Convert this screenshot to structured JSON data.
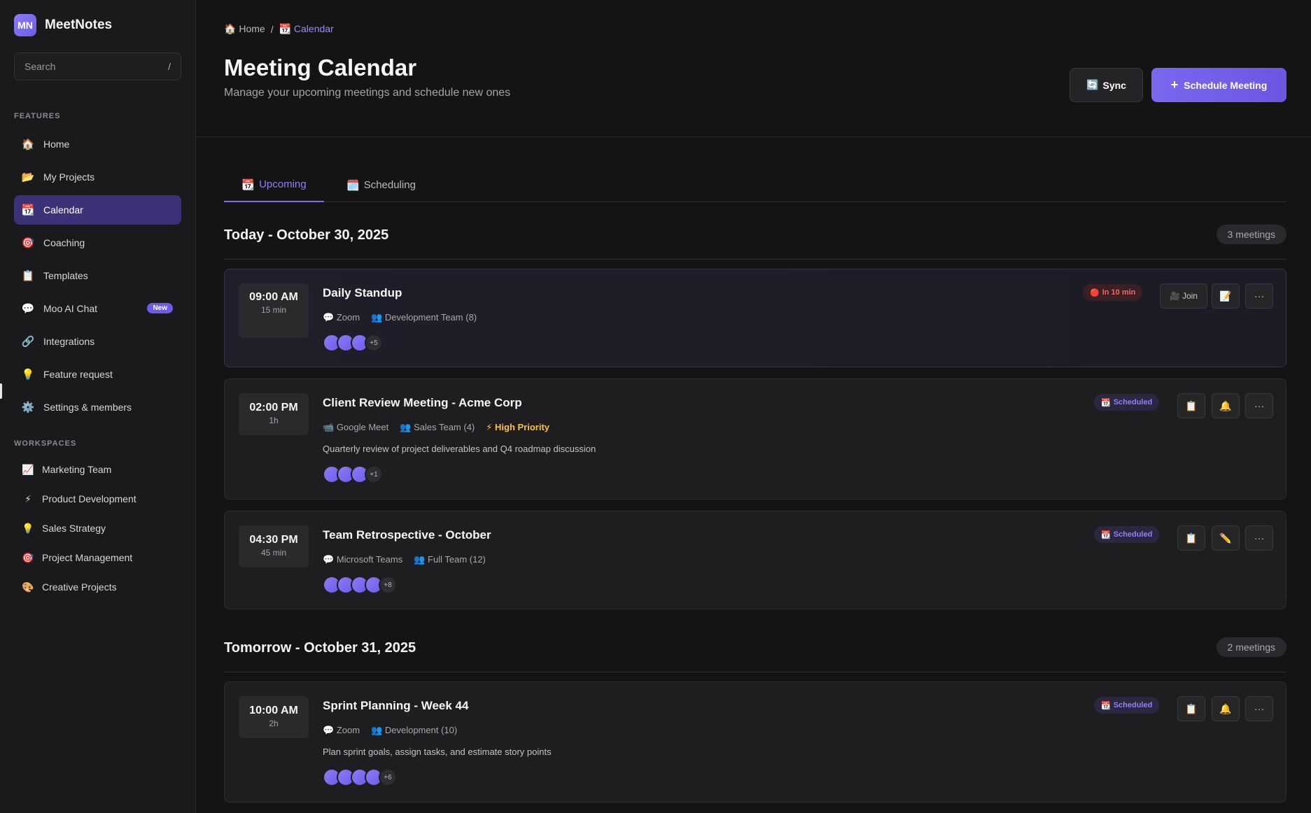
{
  "brand": {
    "logo": "MN",
    "name": "MeetNotes"
  },
  "search": {
    "placeholder": "Search",
    "shortcut": "/"
  },
  "sidebar": {
    "features_label": "FEATURES",
    "items": [
      {
        "icon": "🏠",
        "label": "Home"
      },
      {
        "icon": "📂",
        "label": "My Projects"
      },
      {
        "icon": "📆",
        "label": "Calendar"
      },
      {
        "icon": "🎯",
        "label": "Coaching"
      },
      {
        "icon": "📋",
        "label": "Templates"
      },
      {
        "icon": "💬",
        "label": "Moo AI Chat",
        "badge": "New"
      },
      {
        "icon": "🔗",
        "label": "Integrations"
      },
      {
        "icon": "💡",
        "label": "Feature request"
      },
      {
        "icon": "⚙️",
        "label": "Settings & members"
      }
    ],
    "workspaces_label": "WORKSPACES",
    "workspaces": [
      {
        "icon": "📈",
        "label": "Marketing Team"
      },
      {
        "icon": "⚡",
        "label": "Product Development"
      },
      {
        "icon": "💡",
        "label": "Sales Strategy"
      },
      {
        "icon": "🎯",
        "label": "Project Management"
      },
      {
        "icon": "🎨",
        "label": "Creative Projects"
      }
    ]
  },
  "breadcrumb": {
    "home_icon": "🏠",
    "home": "Home",
    "sep": "/",
    "current_icon": "📆",
    "current": "Calendar"
  },
  "header": {
    "title": "Meeting Calendar",
    "subtitle": "Manage your upcoming meetings and schedule new ones",
    "sync_icon": "🔄",
    "sync_label": "Sync",
    "schedule_icon": "+",
    "schedule_label": "Schedule Meeting"
  },
  "tabs": [
    {
      "icon": "📆",
      "label": "Upcoming"
    },
    {
      "icon": "🗓️",
      "label": "Scheduling"
    }
  ],
  "days": [
    {
      "title": "Today - October 30, 2025",
      "count": "3 meetings",
      "meetings": [
        {
          "time": "09:00 AM",
          "duration": "15 min",
          "title": "Daily Standup",
          "platform_icon": "💬",
          "platform": "Zoom",
          "team_icon": "👥",
          "team": "Development Team (8)",
          "more": "+5",
          "status_icon": "🔴",
          "status": "In 10 min",
          "join_icon": "🎥",
          "join_label": "Join",
          "act1_icon": "📝",
          "act_more": "···"
        },
        {
          "time": "02:00 PM",
          "duration": "1h",
          "title": "Client Review Meeting - Acme Corp",
          "platform_icon": "📹",
          "platform": "Google Meet",
          "team_icon": "👥",
          "team": "Sales Team (4)",
          "priority_icon": "⚡",
          "priority": "High Priority",
          "description": "Quarterly review of project deliverables and Q4 roadmap discussion",
          "more": "+1",
          "status_icon": "📆",
          "status": "Scheduled",
          "act1_icon": "📋",
          "act2_icon": "🔔",
          "act_more": "···"
        },
        {
          "time": "04:30 PM",
          "duration": "45 min",
          "title": "Team Retrospective - October",
          "platform_icon": "💬",
          "platform": "Microsoft Teams",
          "team_icon": "👥",
          "team": "Full Team (12)",
          "more": "+8",
          "status_icon": "📆",
          "status": "Scheduled",
          "act1_icon": "📋",
          "act2_icon": "✏️",
          "act_more": "···"
        }
      ]
    },
    {
      "title": "Tomorrow - October 31, 2025",
      "count": "2 meetings",
      "meetings": [
        {
          "time": "10:00 AM",
          "duration": "2h",
          "title": "Sprint Planning - Week 44",
          "platform_icon": "💬",
          "platform": "Zoom",
          "team_icon": "👥",
          "team": "Development (10)",
          "description": "Plan sprint goals, assign tasks, and estimate story points",
          "more": "+6",
          "status_icon": "📆",
          "status": "Scheduled",
          "act1_icon": "📋",
          "act2_icon": "🔔",
          "act_more": "···"
        }
      ]
    }
  ]
}
